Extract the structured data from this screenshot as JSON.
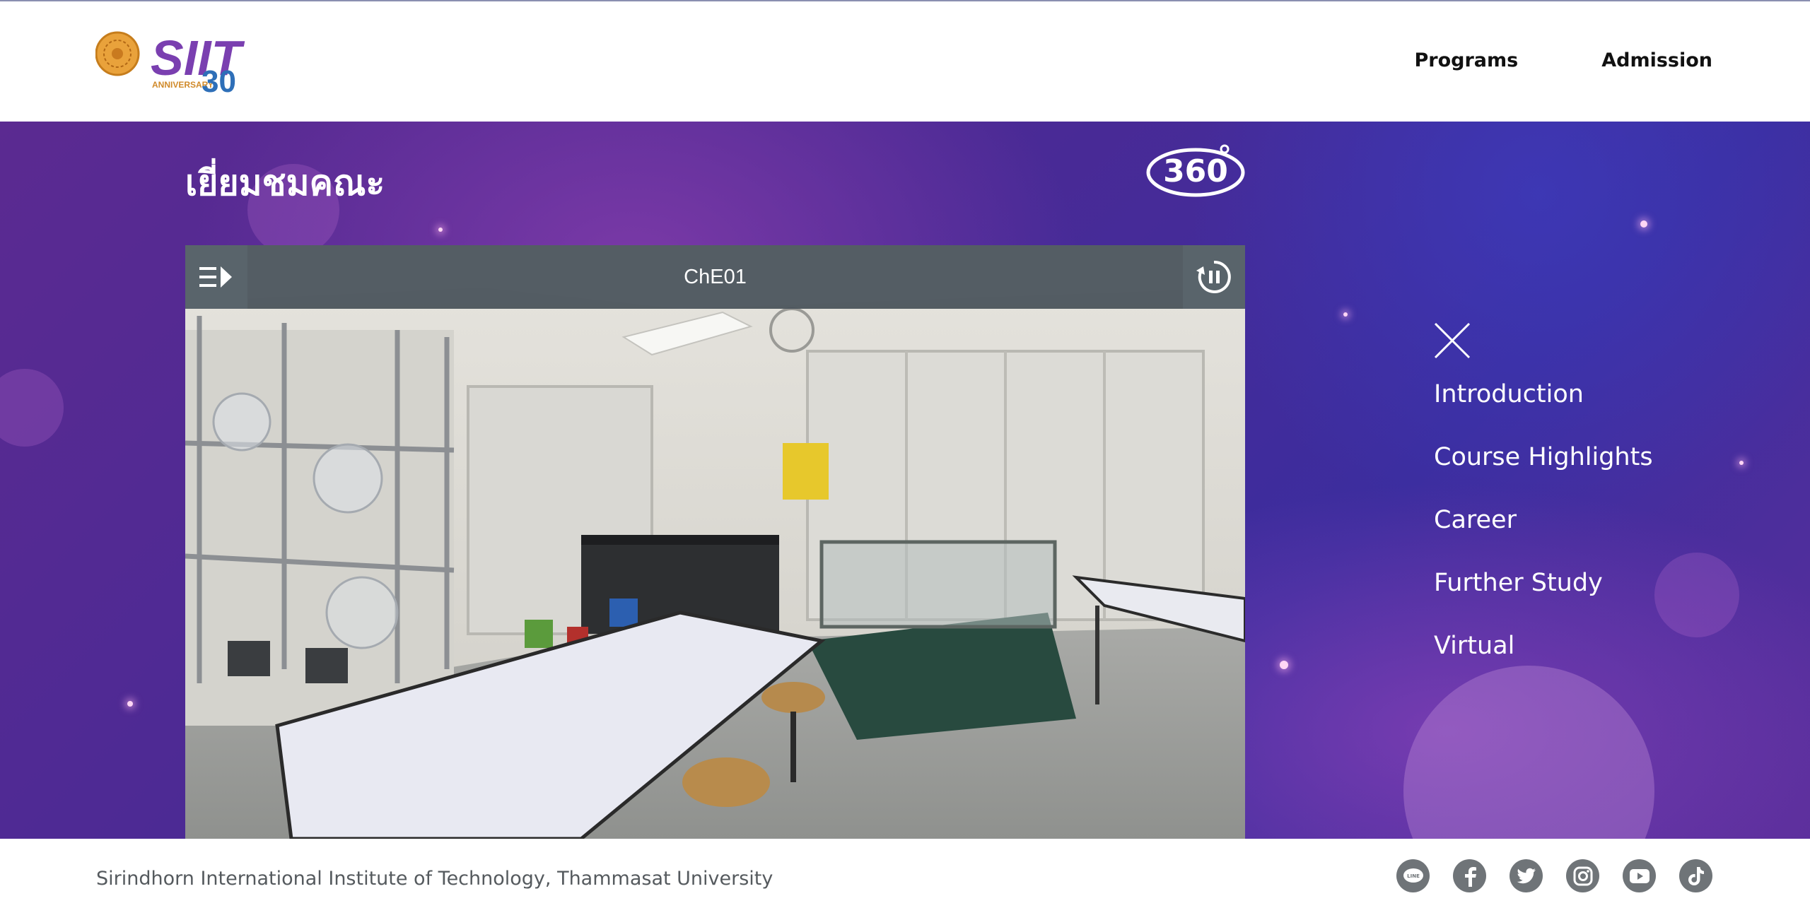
{
  "header": {
    "logo_text": "SIIT",
    "logo_sub": "ANNIVERSARY",
    "logo_year": "30",
    "nav": [
      {
        "label": "Programs"
      },
      {
        "label": "Admission"
      }
    ]
  },
  "hero": {
    "title": "เยี่ยมชมคณะ",
    "badge": "360",
    "viewer": {
      "scene_title": "ChE01"
    },
    "menu": [
      {
        "label": "Introduction"
      },
      {
        "label": "Course Highlights"
      },
      {
        "label": "Career"
      },
      {
        "label": "Further Study"
      },
      {
        "label": "Virtual"
      }
    ]
  },
  "footer": {
    "text": "Sirindhorn International Institute of Technology, Thammasat University",
    "socials": [
      "line-icon",
      "facebook-icon",
      "twitter-icon",
      "instagram-icon",
      "youtube-icon",
      "tiktok-icon"
    ]
  },
  "colors": {
    "hero_purple": "#5b2a91",
    "hero_blue": "#3c2d9e",
    "social_gray": "#6f7478",
    "viewer_bar": "#46505a"
  }
}
